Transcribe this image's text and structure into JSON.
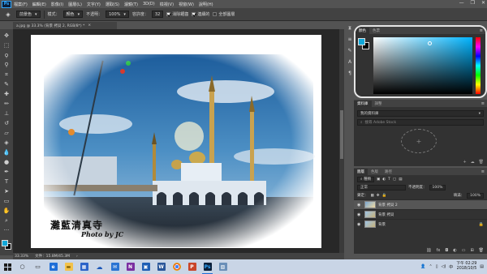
{
  "menubar": {
    "logo": "Ps",
    "items": [
      "檔案(F)",
      "編輯(E)",
      "影像(I)",
      "圖層(L)",
      "文字(Y)",
      "選取(S)",
      "濾鏡(T)",
      "3D(D)",
      "檢視(V)",
      "視窗(W)",
      "說明(H)"
    ]
  },
  "options": {
    "preset": "前景色",
    "mode_label": "模式：",
    "mode_value": "顏色",
    "opacity_label": "不透明：",
    "opacity_value": "100%",
    "tolerance_label": "容許度：",
    "tolerance_value": "32",
    "antialias": "消除鋸齒",
    "contiguous": "連續的",
    "all_layers": "全部圖層"
  },
  "document": {
    "tab_title": "a.jpg @ 33.3% (背景 拷貝 2, RGB/8*) *",
    "photo_caption": "灘藍清真寺",
    "photo_credit": "Photo by JC"
  },
  "status": {
    "zoom": "33.33%",
    "docsize": "文件：15.8M/45.3M"
  },
  "color_panel": {
    "tabs": [
      "顏色",
      "色票"
    ],
    "fg_color": "#11a7d8",
    "bg_color": "#000000"
  },
  "library_panel": {
    "tabs": [
      "資料庫",
      "調整"
    ],
    "library_name": "我的資料庫",
    "search_placeholder": "搜尋 Adobe Stock"
  },
  "layers_panel": {
    "tabs": [
      "圖層",
      "色版",
      "路徑"
    ],
    "kind_filter": "種類",
    "blend_mode": "正常",
    "opacity_label": "不透明度：",
    "opacity_value": "100%",
    "lock_label": "鎖定：",
    "fill_label": "填滿：",
    "fill_value": "100%",
    "layers": [
      {
        "name": "背景 拷貝 2",
        "selected": true
      },
      {
        "name": "背景 拷貝",
        "selected": false
      },
      {
        "name": "背景",
        "selected": false
      }
    ]
  },
  "taskbar": {
    "time": "下午 02:29",
    "date": "2018/10/5",
    "lang": "中"
  }
}
